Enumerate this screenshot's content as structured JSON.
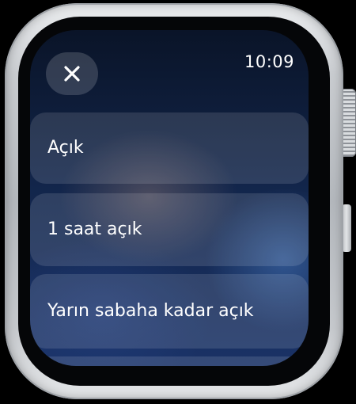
{
  "status_bar": {
    "time": "10:09"
  },
  "close_button": {
    "icon": "close-icon"
  },
  "options": [
    {
      "label": "Açık"
    },
    {
      "label": "1 saat açık"
    },
    {
      "label": "Yarın sabaha kadar açık"
    }
  ],
  "colors": {
    "text": "#FFFFFF",
    "card": "rgba(255,255,255,0.12)",
    "background_top": "#0A1428",
    "background_bottom": "#1A3266"
  }
}
